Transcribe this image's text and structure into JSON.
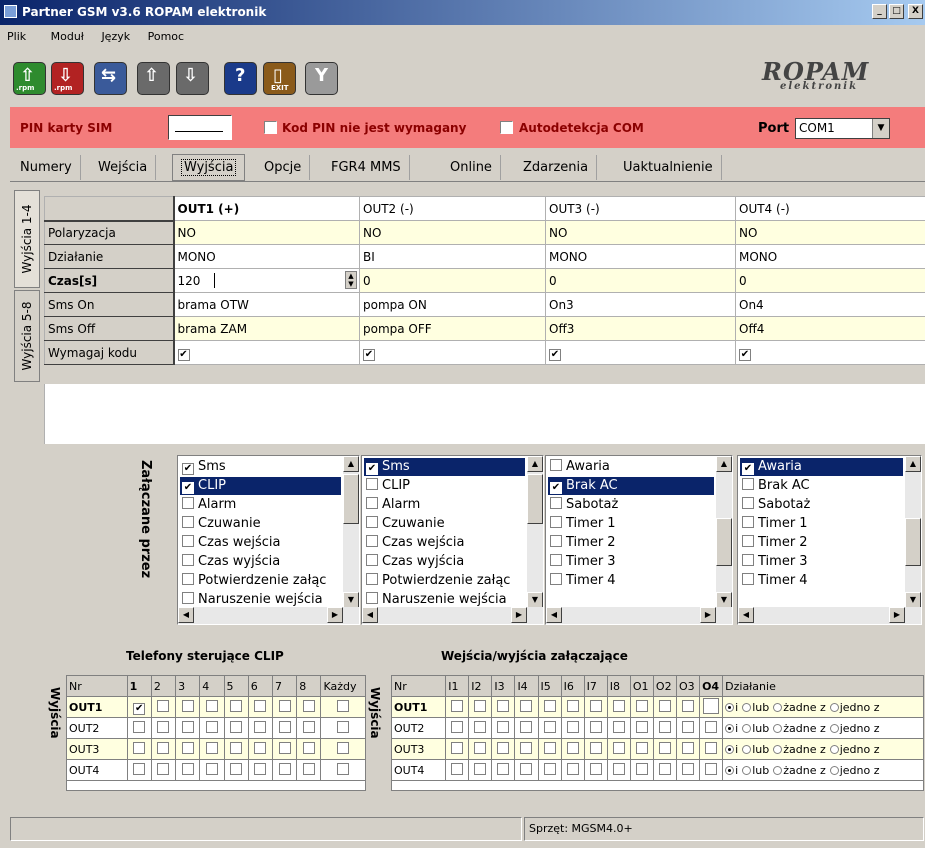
{
  "window": {
    "title": "Partner GSM v3.6 ROPAM elektronik",
    "minimize": "_",
    "maximize": "□",
    "close": "X"
  },
  "menu": [
    "Plik",
    "Moduł",
    "Język",
    "Pomoc"
  ],
  "toolbar": {
    "buttons": [
      {
        "name": "load-rpm",
        "label": ".rpm",
        "color": "#2e8b2e"
      },
      {
        "name": "save-rpm",
        "label": ".rpm",
        "color": "#b22222"
      },
      {
        "name": "send",
        "label": "",
        "color": "#3a5a9a"
      },
      {
        "name": "read-module",
        "label": "",
        "color": "#6a6a6a"
      },
      {
        "name": "write-module",
        "label": "",
        "color": "#6a6a6a"
      },
      {
        "name": "help",
        "label": "?",
        "color": "#1a3a8a"
      },
      {
        "name": "exit",
        "label": "EXIT",
        "color": "#8a5a1a"
      },
      {
        "name": "wireless",
        "label": "",
        "color": "#9a9a9a"
      }
    ],
    "logo": {
      "main": "ROPAM",
      "sub": "elektronik"
    }
  },
  "pin": {
    "label": "PIN karty SIM",
    "value": "",
    "no_pin_label": "Kod PIN nie jest wymagany",
    "autodetect_label": "Autodetekcja COM",
    "port_label": "Port",
    "port_value": "COM1"
  },
  "tabs": [
    "Numery",
    "Wejścia",
    "Wyjścia",
    "Opcje",
    "FGR4 MMS",
    "Online",
    "Zdarzenia",
    "Uaktualnienie"
  ],
  "selected_tab": "Wyjścia",
  "side_tabs": [
    "Wyjścia 1-4",
    "Wyjścia 5-8"
  ],
  "grid": {
    "headers": [
      "OUT1 (+)",
      "OUT2 (-)",
      "OUT3 (-)",
      "OUT4 (-)"
    ],
    "rows": [
      {
        "label": "Polaryzacja",
        "values": [
          "NO",
          "NO",
          "NO",
          "NO"
        ]
      },
      {
        "label": "Działanie",
        "values": [
          "MONO",
          "BI",
          "MONO",
          "MONO"
        ]
      },
      {
        "label": "Czas[s]",
        "values": [
          "120",
          "0",
          "0",
          "0"
        ]
      },
      {
        "label": "Sms On",
        "values": [
          "brama OTW",
          "pompa ON",
          "On3",
          "On4"
        ]
      },
      {
        "label": "Sms Off",
        "values": [
          "brama ZAM",
          "pompa OFF",
          "Off3",
          "Off4"
        ]
      },
      {
        "label": "Wymagaj kodu",
        "values": [
          "✔",
          "✔",
          "✔",
          "✔"
        ]
      }
    ]
  },
  "triggered_by_label": "Załączane przez",
  "listboxes": [
    {
      "items": [
        {
          "t": "Sms",
          "c": true,
          "s": false
        },
        {
          "t": "CLIP",
          "c": true,
          "s": true
        },
        {
          "t": "Alarm",
          "c": false,
          "s": false
        },
        {
          "t": "Czuwanie",
          "c": false,
          "s": false
        },
        {
          "t": "Czas wejścia",
          "c": false,
          "s": false
        },
        {
          "t": "Czas wyjścia",
          "c": false,
          "s": false
        },
        {
          "t": "Potwierdzenie załąc",
          "c": false,
          "s": false
        },
        {
          "t": "Naruszenie wejścia",
          "c": false,
          "s": false
        }
      ]
    },
    {
      "items": [
        {
          "t": "Sms",
          "c": true,
          "s": true
        },
        {
          "t": "CLIP",
          "c": false,
          "s": false
        },
        {
          "t": "Alarm",
          "c": false,
          "s": false
        },
        {
          "t": "Czuwanie",
          "c": false,
          "s": false
        },
        {
          "t": "Czas wejścia",
          "c": false,
          "s": false
        },
        {
          "t": "Czas wyjścia",
          "c": false,
          "s": false
        },
        {
          "t": "Potwierdzenie załąc",
          "c": false,
          "s": false
        },
        {
          "t": "Naruszenie wejścia",
          "c": false,
          "s": false
        }
      ]
    },
    {
      "items": [
        {
          "t": "Awaria",
          "c": false,
          "s": false
        },
        {
          "t": "Brak AC",
          "c": true,
          "s": true
        },
        {
          "t": "Sabotaż",
          "c": false,
          "s": false
        },
        {
          "t": "Timer 1",
          "c": false,
          "s": false
        },
        {
          "t": "Timer 2",
          "c": false,
          "s": false
        },
        {
          "t": "Timer 3",
          "c": false,
          "s": false
        },
        {
          "t": "Timer 4",
          "c": false,
          "s": false
        }
      ]
    },
    {
      "items": [
        {
          "t": "Awaria",
          "c": true,
          "s": true
        },
        {
          "t": "Brak AC",
          "c": false,
          "s": false
        },
        {
          "t": "Sabotaż",
          "c": false,
          "s": false
        },
        {
          "t": "Timer 1",
          "c": false,
          "s": false
        },
        {
          "t": "Timer 2",
          "c": false,
          "s": false
        },
        {
          "t": "Timer 3",
          "c": false,
          "s": false
        },
        {
          "t": "Timer 4",
          "c": false,
          "s": false
        }
      ]
    }
  ],
  "clip": {
    "title": "Telefony sterujące CLIP",
    "side_label": "Wyjścia",
    "headers": [
      "Nr",
      "1",
      "2",
      "3",
      "4",
      "5",
      "6",
      "7",
      "8",
      "Każdy"
    ],
    "rows": [
      {
        "label": "OUT1",
        "checks": [
          true,
          false,
          false,
          false,
          false,
          false,
          false,
          false,
          false
        ]
      },
      {
        "label": "OUT2",
        "checks": [
          false,
          false,
          false,
          false,
          false,
          false,
          false,
          false,
          false
        ]
      },
      {
        "label": "OUT3",
        "checks": [
          false,
          false,
          false,
          false,
          false,
          false,
          false,
          false,
          false
        ]
      },
      {
        "label": "OUT4",
        "checks": [
          false,
          false,
          false,
          false,
          false,
          false,
          false,
          false,
          false
        ]
      }
    ]
  },
  "io": {
    "title": "Wejścia/wyjścia załączające",
    "side_label": "Wyjścia",
    "headers": [
      "Nr",
      "I1",
      "I2",
      "I3",
      "I4",
      "I5",
      "I6",
      "I7",
      "I8",
      "O1",
      "O2",
      "O3",
      "O4",
      "Działanie"
    ],
    "rows": [
      {
        "label": "OUT1",
        "mode": "i"
      },
      {
        "label": "OUT2",
        "mode": "i"
      },
      {
        "label": "OUT3",
        "mode": "i"
      },
      {
        "label": "OUT4",
        "mode": "i"
      }
    ],
    "options": [
      "i",
      "lub",
      "żadne z",
      "jedno z"
    ]
  },
  "status": {
    "left": "",
    "hardware": "Sprzęt: MGSM4.0+"
  }
}
